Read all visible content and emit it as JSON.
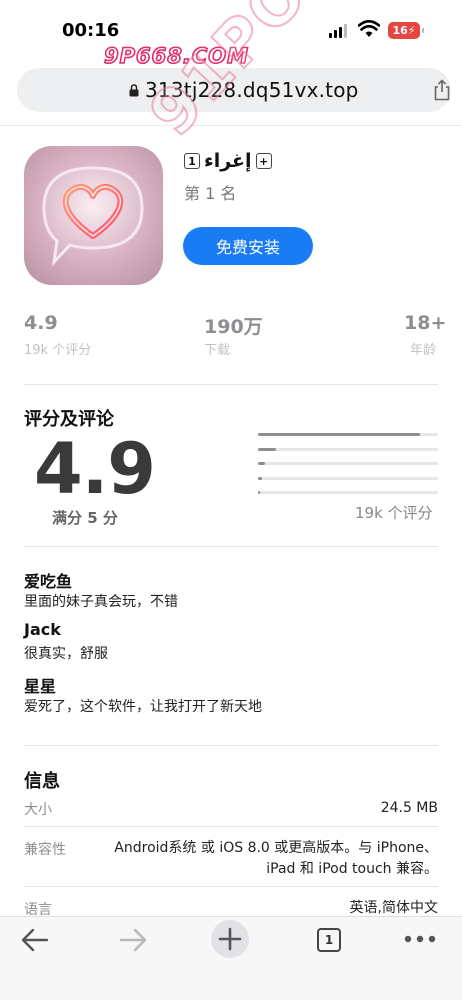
{
  "status_bar": {
    "time": "00:16",
    "battery": "16"
  },
  "watermark": {
    "top": "9P668.COM",
    "diagonal": "91PORN.COM"
  },
  "address_bar": {
    "url": "313tj228.dq51vx.top"
  },
  "app": {
    "name": "إغراء",
    "rank": "第 1 名",
    "install_label": "免费安装"
  },
  "stats": [
    {
      "value": "4.9",
      "sub": "19k 个评分"
    },
    {
      "value": "190万",
      "sub": "下载"
    },
    {
      "value": "18+",
      "sub": "年龄"
    }
  ],
  "ratings": {
    "title": "评分及评论",
    "score": "4.9",
    "out_of": "满分 5 分",
    "count": "19k 个评分",
    "distribution": [
      0.9,
      0.1,
      0.04,
      0.02,
      0.01
    ]
  },
  "reviews": [
    {
      "name": "爱吃鱼",
      "text": "里面的妹子真会玩，不错"
    },
    {
      "name": "Jack",
      "text": "很真实，舒服"
    },
    {
      "name": "星星",
      "text": "爱死了，这个软件，让我打开了新天地"
    }
  ],
  "info": {
    "title": "信息",
    "rows": [
      {
        "label": "大小",
        "value": "24.5 MB"
      },
      {
        "label": "兼容性",
        "value_line1": "Android系统 或 iOS 8.0 或更高版本。与 iPhone、",
        "value_line2": "iPad 和 iPod touch 兼容。"
      },
      {
        "label": "语言",
        "value": "英语,简体中文"
      }
    ]
  },
  "toolbar": {
    "tab_count": "1"
  },
  "colors": {
    "accent": "#1a7cf5",
    "battery": "#e4473f",
    "watermark": "#e0306a"
  },
  "icons": [
    "lock-icon",
    "share-icon",
    "back-icon",
    "forward-icon",
    "new-tab-icon",
    "tabs-icon",
    "more-icon"
  ]
}
